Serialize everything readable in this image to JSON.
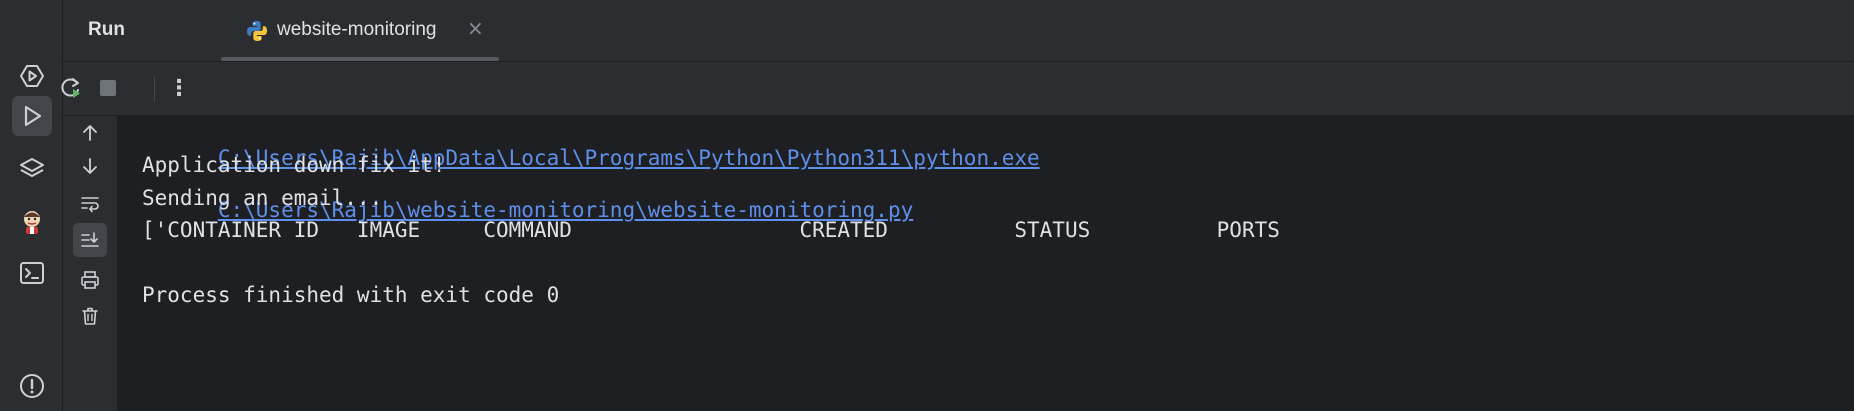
{
  "header": {
    "title": "Run",
    "tabs": [
      {
        "label": "website-monitoring",
        "close": "×"
      }
    ]
  },
  "console": {
    "command_interpreter": "C:\\Users\\Rajib\\AppData\\Local\\Programs\\Python\\Python311\\python.exe",
    "command_script": "C:\\Users\\Rajib\\website-monitoring\\website-monitoring.py",
    "lines": [
      "Application down fix it!",
      "Sending an email...",
      "['CONTAINER ID   IMAGE     COMMAND                  CREATED          STATUS          PORTS",
      "",
      "Process finished with exit code 0"
    ]
  },
  "toolbar": {
    "more_label": "⋮"
  },
  "colors": {
    "background": "#1e1f22",
    "panel": "#2b2d30",
    "link": "#5e8fea",
    "text": "#dfe1e5"
  }
}
